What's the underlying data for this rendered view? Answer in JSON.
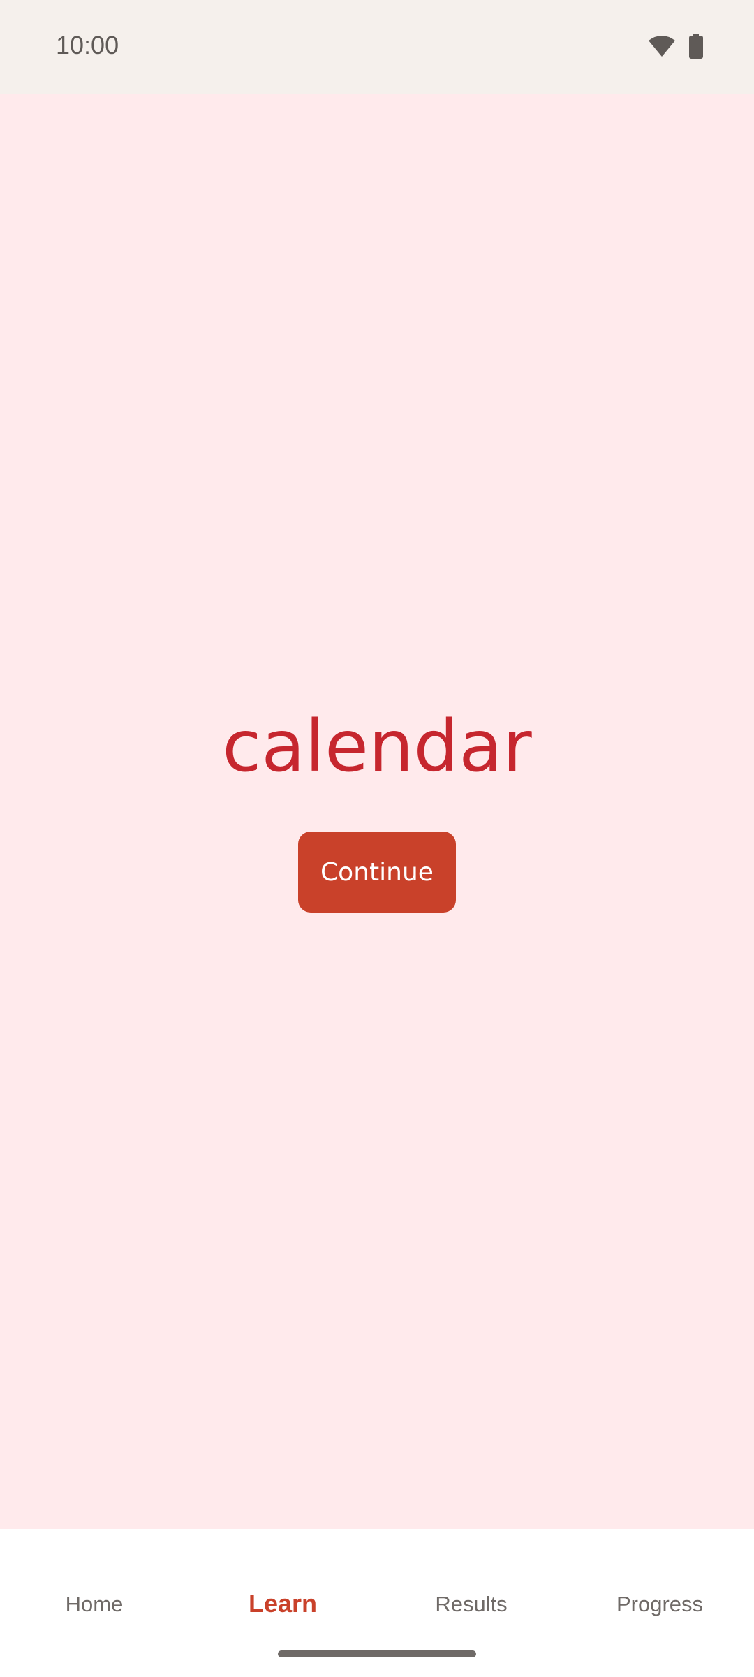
{
  "status_bar": {
    "time": "10:00",
    "icons": [
      "wifi-icon",
      "battery-icon"
    ]
  },
  "main": {
    "word": "calendar",
    "continue_label": "Continue"
  },
  "bottom_nav": {
    "items": [
      {
        "label": "Home",
        "active": false
      },
      {
        "label": "Learn",
        "active": true
      },
      {
        "label": "Results",
        "active": false
      },
      {
        "label": "Progress",
        "active": false
      }
    ]
  },
  "colors": {
    "background": "#ffeaec",
    "accent": "#c9412a",
    "word": "#c6262e",
    "status_bar": "#f5f0ec"
  }
}
